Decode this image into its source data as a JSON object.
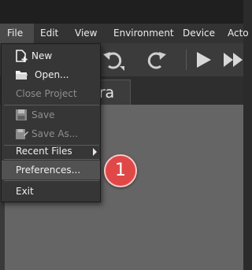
{
  "menubar": {
    "items": [
      "File",
      "Edit",
      "View",
      "Environment",
      "Device",
      "Acto"
    ]
  },
  "toolbar": {
    "buttons": [
      "undo-icon",
      "redo-icon",
      "play-icon",
      "fast-forward-icon"
    ]
  },
  "tabs": {
    "active_label": "era"
  },
  "file_menu": {
    "items": [
      {
        "label": "New",
        "icon": "new-file-icon",
        "enabled": true
      },
      {
        "label": "Open...",
        "icon": "folder-icon",
        "enabled": true
      },
      {
        "label": "Close Project",
        "enabled": false
      },
      {
        "label": "Save",
        "icon": "save-icon",
        "enabled": false
      },
      {
        "label": "Save As...",
        "icon": "save-as-icon",
        "enabled": false
      },
      {
        "label": "Recent Files",
        "enabled": true,
        "submenu": true
      },
      {
        "label": "Preferences...",
        "enabled": true,
        "highlighted": true
      },
      {
        "label": "Exit",
        "enabled": true
      }
    ]
  },
  "callout": {
    "number": "1",
    "color": "#e04848"
  },
  "colors": {
    "menu_bg": "#363636",
    "highlight": "#525252",
    "content_bg": "#656565"
  }
}
